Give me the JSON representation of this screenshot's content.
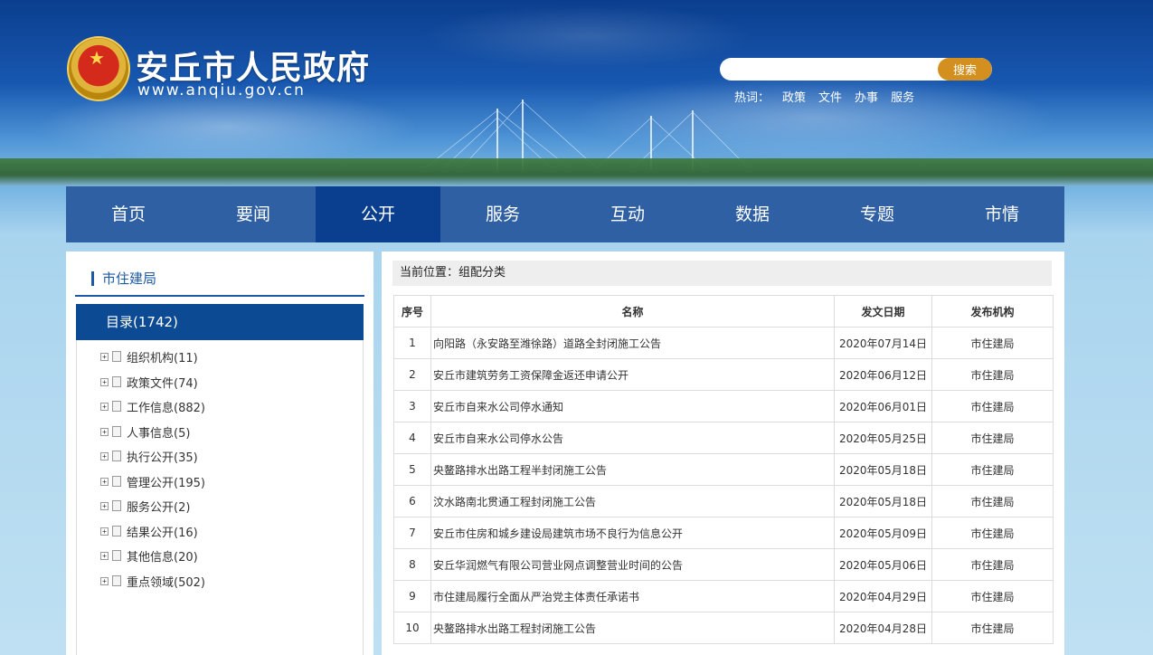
{
  "header": {
    "site_title": "安丘市人民政府",
    "site_url": "www.anqiu.gov.cn",
    "search_placeholder": "",
    "search_button": "搜索",
    "hotwords_label": "热词：",
    "hotwords": [
      "政策",
      "文件",
      "办事",
      "服务"
    ]
  },
  "nav": {
    "items": [
      "首页",
      "要闻",
      "公开",
      "服务",
      "互动",
      "数据",
      "专题",
      "市情"
    ],
    "active_index": 2
  },
  "sidebar": {
    "title": "市住建局",
    "catalog_label": "目录(1742)",
    "items": [
      "组织机构(11)",
      "政策文件(74)",
      "工作信息(882)",
      "人事信息(5)",
      "执行公开(35)",
      "管理公开(195)",
      "服务公开(2)",
      "结果公开(16)",
      "其他信息(20)",
      "重点领域(502)"
    ]
  },
  "main": {
    "breadcrumb": "当前位置：组配分类",
    "columns": [
      "序号",
      "名称",
      "发文日期",
      "发布机构"
    ],
    "rows": [
      [
        "1",
        "向阳路（永安路至潍徐路）道路全封闭施工公告",
        "2020年07月14日",
        "市住建局"
      ],
      [
        "2",
        "安丘市建筑劳务工资保障金返还申请公开",
        "2020年06月12日",
        "市住建局"
      ],
      [
        "3",
        "安丘市自来水公司停水通知",
        "2020年06月01日",
        "市住建局"
      ],
      [
        "4",
        "安丘市自来水公司停水公告",
        "2020年05月25日",
        "市住建局"
      ],
      [
        "5",
        "央鳌路排水出路工程半封闭施工公告",
        "2020年05月18日",
        "市住建局"
      ],
      [
        "6",
        "汶水路南北贯通工程封闭施工公告",
        "2020年05月18日",
        "市住建局"
      ],
      [
        "7",
        "安丘市住房和城乡建设局建筑市场不良行为信息公开",
        "2020年05月09日",
        "市住建局"
      ],
      [
        "8",
        "安丘华润燃气有限公司营业网点调整营业时间的公告",
        "2020年05月06日",
        "市住建局"
      ],
      [
        "9",
        "市住建局履行全面从严治党主体责任承诺书",
        "2020年04月29日",
        "市住建局"
      ],
      [
        "10",
        "央鳌路排水出路工程封闭施工公告",
        "2020年04月28日",
        "市住建局"
      ]
    ]
  }
}
